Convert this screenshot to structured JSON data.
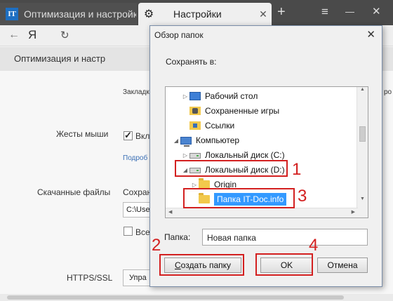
{
  "browser": {
    "tab1_logo": "IT",
    "tab1_title": "Оптимизация и настройка",
    "tab2_title": "Настройки",
    "tab_close": "✕",
    "new_tab": "+",
    "menu_glyph": "≡",
    "minimize_glyph": "—",
    "close_glyph": "✕",
    "back_glyph": "←",
    "yandex_glyph": "Я",
    "reload_glyph": "↻"
  },
  "page": {
    "header": "Оптимизация и настр",
    "bookmarks_label": "Закладк",
    "right_clip": "ро",
    "mouse_gestures_label": "Жесты мыши",
    "mouse_gestures_check_text": "Вкл",
    "mouse_gestures_link": "Подроб",
    "downloads_label": "Скачанные файлы",
    "downloads_save_text": "Сохран",
    "downloads_path": "C:\\Use",
    "downloads_always_text": "Всег",
    "https_label": "HTTPS/SSL",
    "https_button": "Упра"
  },
  "dialog": {
    "title": "Обзор папок",
    "close_glyph": "✕",
    "save_to_label": "Сохранять в:",
    "tree": [
      {
        "label": "Рабочий стол",
        "icon": "desktop-icon",
        "arrow": "▷"
      },
      {
        "label": "Сохраненные игры",
        "icon": "saved-games-icon",
        "arrow": ""
      },
      {
        "label": "Ссылки",
        "icon": "links-icon",
        "arrow": ""
      },
      {
        "label": "Компьютер",
        "icon": "computer-icon",
        "arrow": "◢"
      },
      {
        "label": "Локальный диск (C:)",
        "icon": "drive-icon",
        "arrow": "▷"
      },
      {
        "label": "Локальный диск (D:)",
        "icon": "drive-icon",
        "arrow": "◢"
      },
      {
        "label": "Origin",
        "icon": "folder-icon",
        "arrow": "▷"
      },
      {
        "label": "Папка IT-Doc.info",
        "icon": "folder-icon",
        "arrow": ""
      }
    ],
    "folder_label": "Папка:",
    "folder_value": "Новая папка",
    "create_folder_button": "Создать папку",
    "create_folder_mnemonic": "С",
    "ok_button": "OK",
    "cancel_button": "Отмена"
  },
  "annotations": {
    "num1": "1",
    "num2": "2",
    "num3": "3",
    "num4": "4",
    "color": "#d32020"
  }
}
